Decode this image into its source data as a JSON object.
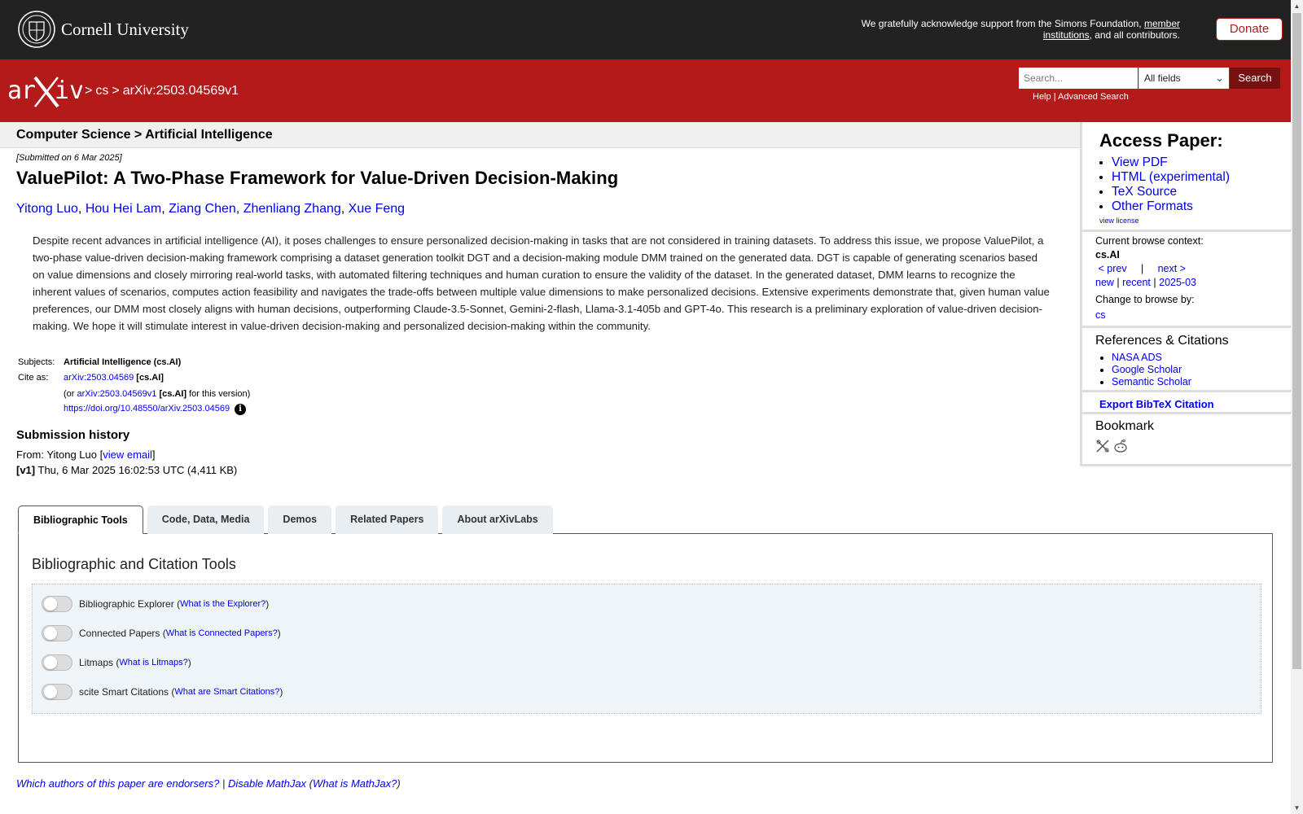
{
  "top_bar": {
    "university": "Cornell University",
    "ack_text": "We gratefully acknowledge support from the Simons Foundation,",
    "ack_link": "member institutions",
    "ack_tail": ", and all contributors.",
    "donate": "Donate"
  },
  "header": {
    "crumb1": ">",
    "crumb_cs": "cs",
    "crumb2": ">",
    "crumb_id": "arXiv:2503.04569v1",
    "search_placeholder": "Search...",
    "search_field": "All fields",
    "search_button": "Search",
    "help": "Help",
    "separator": "|",
    "advanced": "Advanced Search"
  },
  "subheader": "Computer Science > Artificial Intelligence",
  "paper": {
    "submitted": "[Submitted on 6 Mar 2025]",
    "title": "ValuePilot: A Two-Phase Framework for Value-Driven Decision-Making",
    "authors": [
      "Yitong Luo",
      "Hou Hei Lam",
      "Ziang Chen",
      "Zhenliang Zhang",
      "Xue Feng"
    ],
    "abstract": "Despite recent advances in artificial intelligence (AI), it poses challenges to ensure personalized decision-making in tasks that are not considered in training datasets. To address this issue, we propose ValuePilot, a two-phase value-driven decision-making framework comprising a dataset generation toolkit DGT and a decision-making module DMM trained on the generated data. DGT is capable of generating scenarios based on value dimensions and closely mirroring real-world tasks, with automated filtering techniques and human curation to ensure the validity of the dataset. In the generated dataset, DMM learns to recognize the inherent values of scenarios, computes action feasibility and navigates the trade-offs between multiple value dimensions to make personalized decisions. Extensive experiments demonstrate that, given human value preferences, our DMM most closely aligns with human decisions, outperforming Claude-3.5-Sonnet, Gemini-2-flash, Llama-3.1-405b and GPT-4o. This research is a preliminary exploration of value-driven decision-making. We hope it will stimulate interest in value-driven decision-making and personalized decision-making within the community."
  },
  "meta": {
    "subjects_label": "Subjects:",
    "subjects_value": "Artificial Intelligence (cs.AI)",
    "cite_label": "Cite as:",
    "cite_link": "arXiv:2503.04569",
    "cite_tag": "[cs.AI]",
    "or_prefix": "(or",
    "version_link": "arXiv:2503.04569v1",
    "version_tag": "[cs.AI]",
    "version_suffix": "for this version)",
    "doi": "https://doi.org/10.48550/arXiv.2503.04569",
    "info_icon": "i"
  },
  "history": {
    "title": "Submission history",
    "from": "From: Yitong Luo [",
    "view_email": "view email",
    "close": "]",
    "v1_label": "[v1]",
    "v1_text": "Thu, 6 Mar 2025 16:02:53 UTC (4,411 KB)"
  },
  "tabs": [
    "Bibliographic Tools",
    "Code, Data, Media",
    "Demos",
    "Related Papers",
    "About arXivLabs"
  ],
  "panel": {
    "title": "Bibliographic and Citation Tools",
    "tools": [
      {
        "label": "Bibliographic Explorer",
        "help": "What is the Explorer?"
      },
      {
        "label": "Connected Papers",
        "help": "What is Connected Papers?"
      },
      {
        "label": "Litmaps",
        "help": "What is Litmaps?"
      },
      {
        "label": "scite Smart Citations",
        "help": "What are Smart Citations?"
      }
    ]
  },
  "footer": {
    "endorsers": "Which authors of this paper are endorsers?",
    "sep": "|",
    "disable_mathjax": "Disable MathJax",
    "what_mathjax": "What is MathJax?"
  },
  "sidebar": {
    "access_title": "Access Paper:",
    "access_links": [
      "View PDF",
      "HTML (experimental)",
      "TeX Source",
      "Other Formats"
    ],
    "view_license": "view license",
    "browse_context_label": "Current browse context:",
    "browse_context": "cs.AI",
    "prev": "< prev",
    "pipe": "|",
    "next": "next >",
    "new": "new",
    "recent": "recent",
    "month": "2025-03",
    "change_label": "Change to browse by:",
    "change_cs": "cs",
    "refs_title": "References & Citations",
    "refs": [
      "NASA ADS",
      "Google Scholar",
      "Semantic Scholar"
    ],
    "bibtex": "Export BibTeX Citation",
    "bookmark": "Bookmark"
  },
  "colors": {
    "arxiv_red": "#b31b1b",
    "top_bar": "#222222",
    "link": "#0000ee"
  }
}
